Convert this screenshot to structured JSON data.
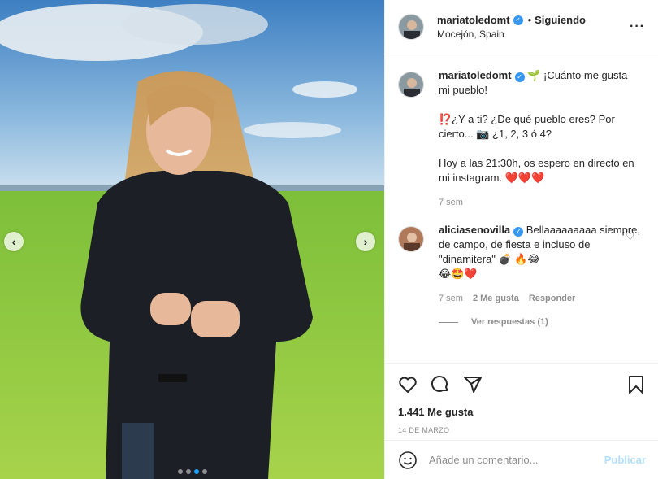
{
  "post": {
    "author": "mariatoledomt",
    "follow_status": "Siguiendo",
    "separator": "•",
    "location": "Mocejón, Spain",
    "more_icon": "more-options-icon",
    "carousel": {
      "slide_count": 4,
      "active_slide": 3
    }
  },
  "caption": {
    "author": "mariatoledomt",
    "text": "🌱 ¡Cuánto me gusta mi pueblo!\n\n⁉️¿Y a ti? ¿De qué pueblo eres? Por cierto... 📷 ¿1, 2, 3 ó 4?\n\nHoy a las 21:30h, os espero en directo en mi instagram. ❤️❤️❤️",
    "time": "7 sem"
  },
  "comment": {
    "author": "aliciasenovilla",
    "text": "Bellaaaaaaaaa siempre, de campo, de fiesta e incluso de \"dinamitera\" 💣 🔥😂\n😂🤩❤️",
    "time": "7 sem",
    "likes": "2 Me gusta",
    "reply": "Responder",
    "view_replies": "Ver respuestas (1)"
  },
  "actions": {
    "likes": "1.441 Me gusta",
    "date": "14 DE MARZO"
  },
  "add_comment": {
    "placeholder": "Añade un comentario...",
    "publish": "Publicar"
  },
  "colors": {
    "verified": "#3897f0",
    "active_dot": "#1aa1fb",
    "publish": "#b2dffc"
  }
}
